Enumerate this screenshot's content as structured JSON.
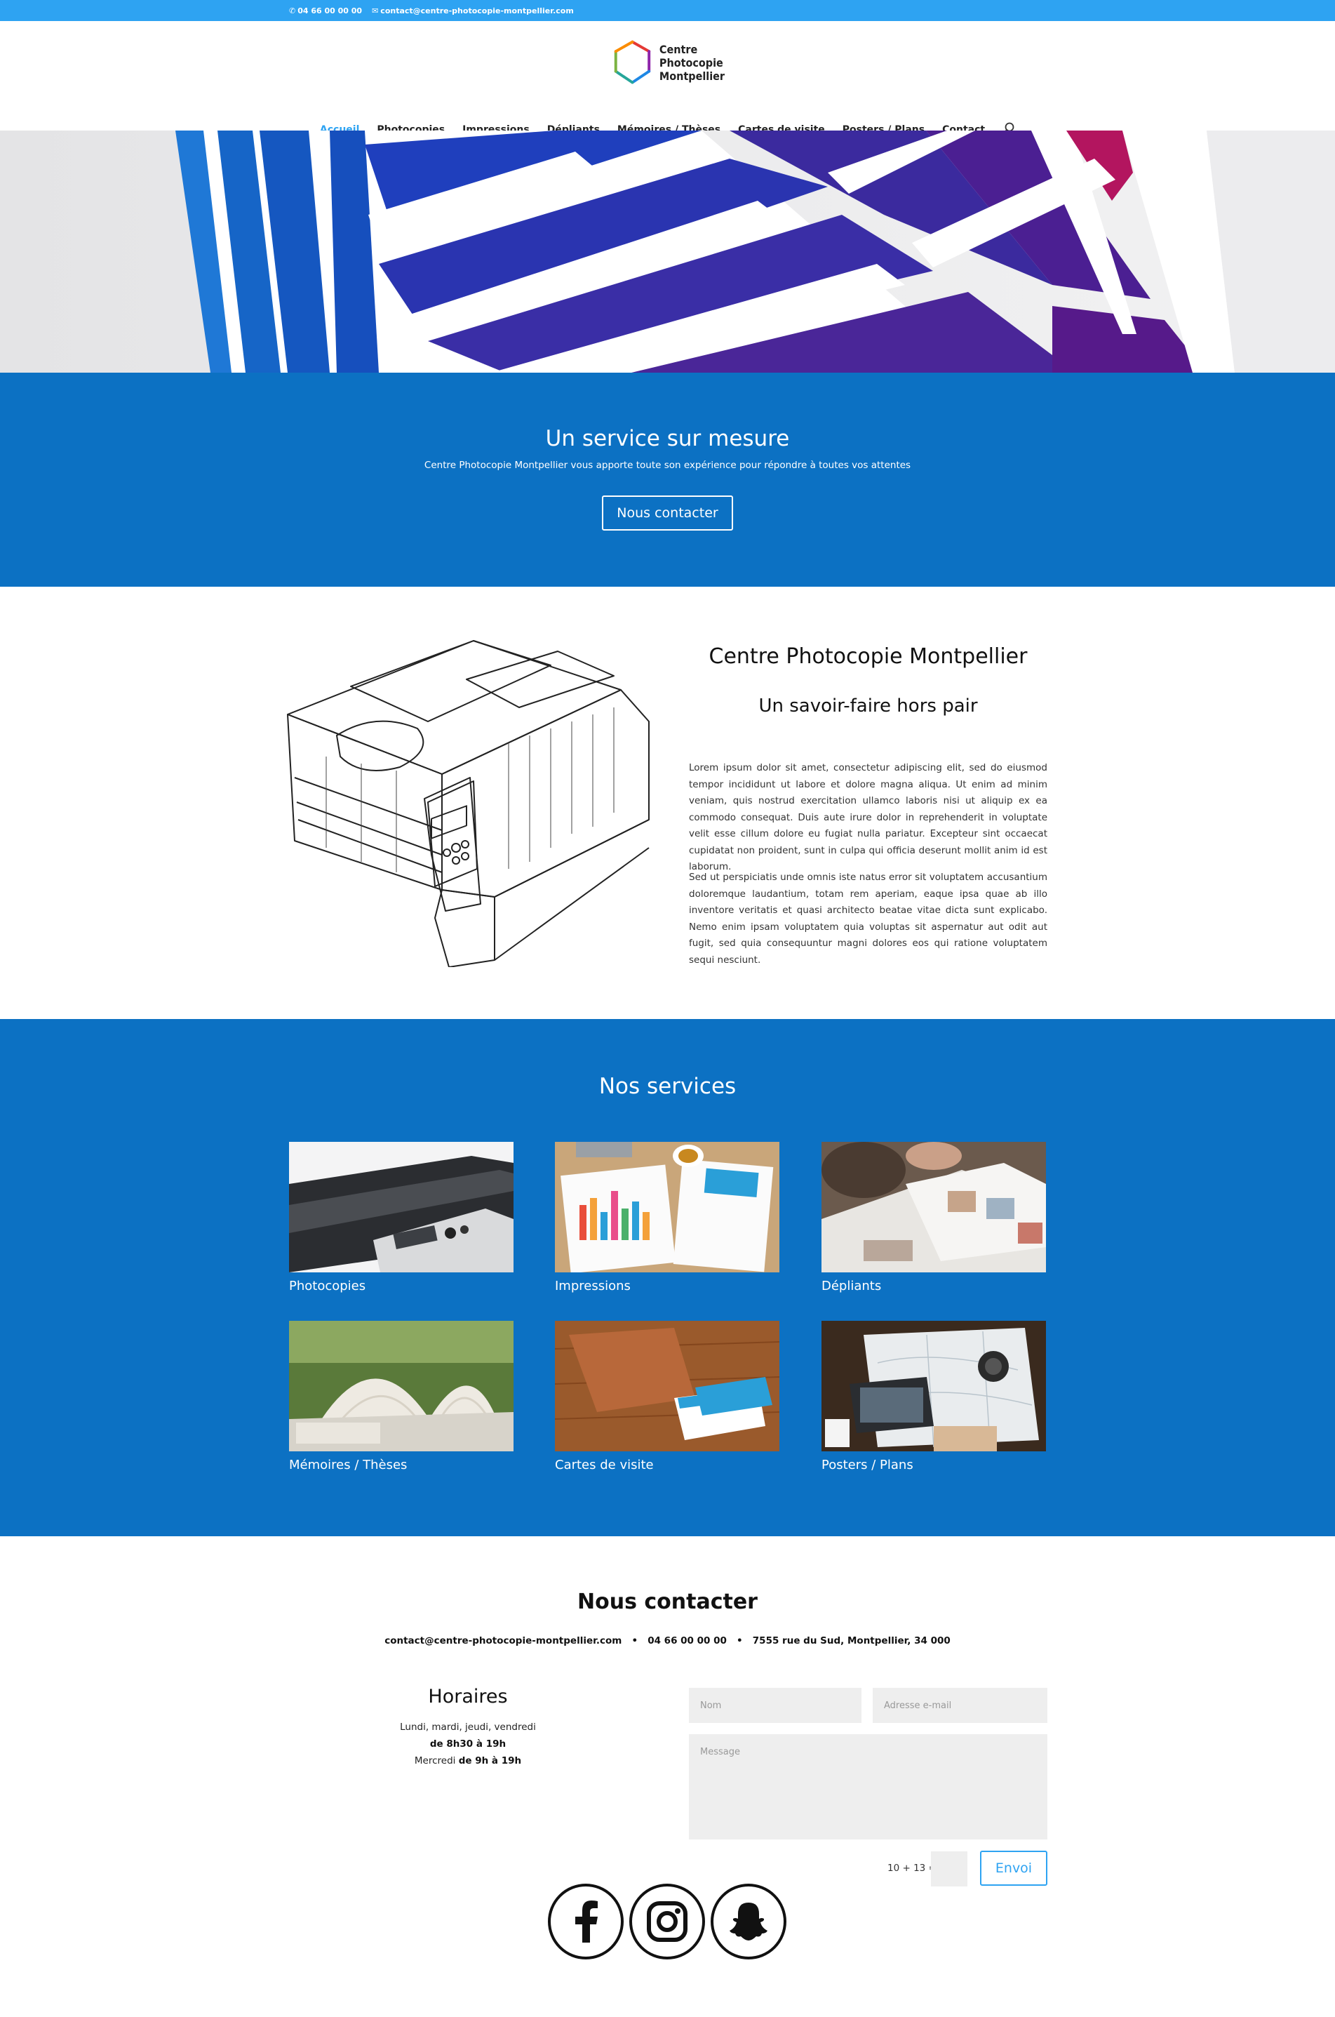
{
  "topbar": {
    "phone": "04 66 00 00 00",
    "email": "contact@centre-photocopie-montpellier.com",
    "phone_icon": "phone-icon",
    "email_icon": "envelope-icon"
  },
  "logo": {
    "line1": "Centre",
    "line2": "Photocopie",
    "line3": "Montpellier"
  },
  "nav": {
    "items": [
      "Accueil",
      "Photocopies",
      "Impressions",
      "Dépliants",
      "Mémoires / Thèses",
      "Cartes de visite",
      "Posters / Plans",
      "Contact"
    ],
    "active": "Accueil",
    "search_icon": "search-icon"
  },
  "hero": {
    "slides": 3,
    "active_slide": 3
  },
  "cta": {
    "title": "Un service sur mesure",
    "subtitle": "Centre Photocopie Montpellier vous apporte toute son expérience pour répondre à toutes vos attentes",
    "button": "Nous contacter"
  },
  "about": {
    "title": "Centre Photocopie Montpellier",
    "subtitle": "Un savoir-faire hors pair",
    "p1": "Lorem ipsum dolor sit amet, consectetur adipiscing elit, sed do eiusmod tempor incididunt ut labore et dolore magna aliqua. Ut enim ad minim veniam, quis nostrud exercitation ullamco laboris nisi ut aliquip ex ea commodo consequat. Duis aute irure dolor in reprehenderit in voluptate velit esse cillum dolore eu fugiat nulla pariatur. Excepteur sint occaecat cupidatat non proident, sunt in culpa qui officia deserunt mollit anim id est laborum.",
    "p2": "Sed ut perspiciatis unde omnis iste natus error sit voluptatem accusantium doloremque laudantium, totam rem aperiam, eaque ipsa quae ab illo inventore veritatis et quasi architecto beatae vitae dicta sunt explicabo. Nemo enim ipsam voluptatem quia voluptas sit aspernatur aut odit aut fugit, sed quia consequuntur magni dolores eos qui ratione voluptatem sequi nesciunt."
  },
  "services": {
    "title": "Nos services",
    "items": [
      {
        "label": "Photocopies"
      },
      {
        "label": "Impressions"
      },
      {
        "label": "Dépliants"
      },
      {
        "label": "Mémoires / Thèses"
      },
      {
        "label": "Cartes de visite"
      },
      {
        "label": "Posters / Plans"
      }
    ]
  },
  "contact": {
    "title": "Nous contacter",
    "email": "contact@centre-photocopie-montpellier.com",
    "phone": "04 66 00 00 00",
    "address": "7555 rue du Sud, Montpellier, 34 000",
    "separator": "•",
    "hours_title": "Horaires",
    "hours_days": "Lundi, mardi, jeudi, vendredi",
    "hours_time1": "de 8h30 à 19h",
    "hours_wed_label": "Mercredi",
    "hours_wed_time": "de 9h à 19h",
    "form": {
      "name_placeholder": "Nom",
      "email_placeholder": "Adresse e-mail",
      "message_placeholder": "Message",
      "captcha": "10 + 13 =",
      "send": "Envoi"
    },
    "socials": [
      "facebook-icon",
      "instagram-icon",
      "snapchat-icon"
    ]
  }
}
